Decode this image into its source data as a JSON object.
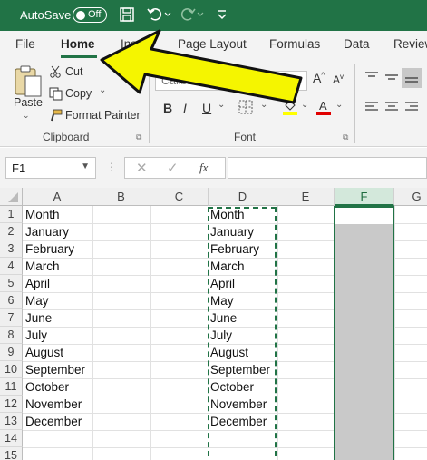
{
  "titlebar": {
    "autosave_label": "AutoSave",
    "autosave_state": "Off",
    "icons": [
      "save-icon",
      "undo-icon",
      "redo-icon",
      "customize-qat-icon"
    ]
  },
  "tabs": [
    {
      "label": "File"
    },
    {
      "label": "Home",
      "active": true
    },
    {
      "label": "Insert"
    },
    {
      "label": "Page Layout"
    },
    {
      "label": "Formulas"
    },
    {
      "label": "Data"
    },
    {
      "label": "Review"
    }
  ],
  "ribbon": {
    "clipboard": {
      "paste_label": "Paste",
      "cut_label": "Cut",
      "copy_label": "Copy",
      "format_painter_label": "Format Painter",
      "group_label": "Clipboard"
    },
    "font": {
      "font_name": "Calibri",
      "bold": "B",
      "italic": "I",
      "underline": "U",
      "group_label": "Font",
      "grow_label": "A",
      "shrink_label": "A"
    }
  },
  "formula_bar": {
    "name_box": "F1",
    "fx_label": "fx",
    "formula_value": ""
  },
  "grid": {
    "columns": [
      "A",
      "B",
      "C",
      "D",
      "E",
      "F",
      "G"
    ],
    "selected_column": "F",
    "rows": [
      "1",
      "2",
      "3",
      "4",
      "5",
      "6",
      "7",
      "8",
      "9",
      "10",
      "11",
      "12",
      "13",
      "14",
      "15"
    ],
    "column_a": [
      "Month",
      "January",
      "February",
      "March",
      "April",
      "May",
      "June",
      "July",
      "August",
      "September",
      "October",
      "November",
      "December"
    ],
    "column_d": [
      "Month",
      "January",
      "February",
      "March",
      "April",
      "May",
      "June",
      "July",
      "August",
      "September",
      "October",
      "November",
      "December"
    ]
  },
  "colors": {
    "excel_green": "#217346",
    "arrow_yellow": "#f5f500",
    "selection_gray": "#c9c9c9"
  }
}
